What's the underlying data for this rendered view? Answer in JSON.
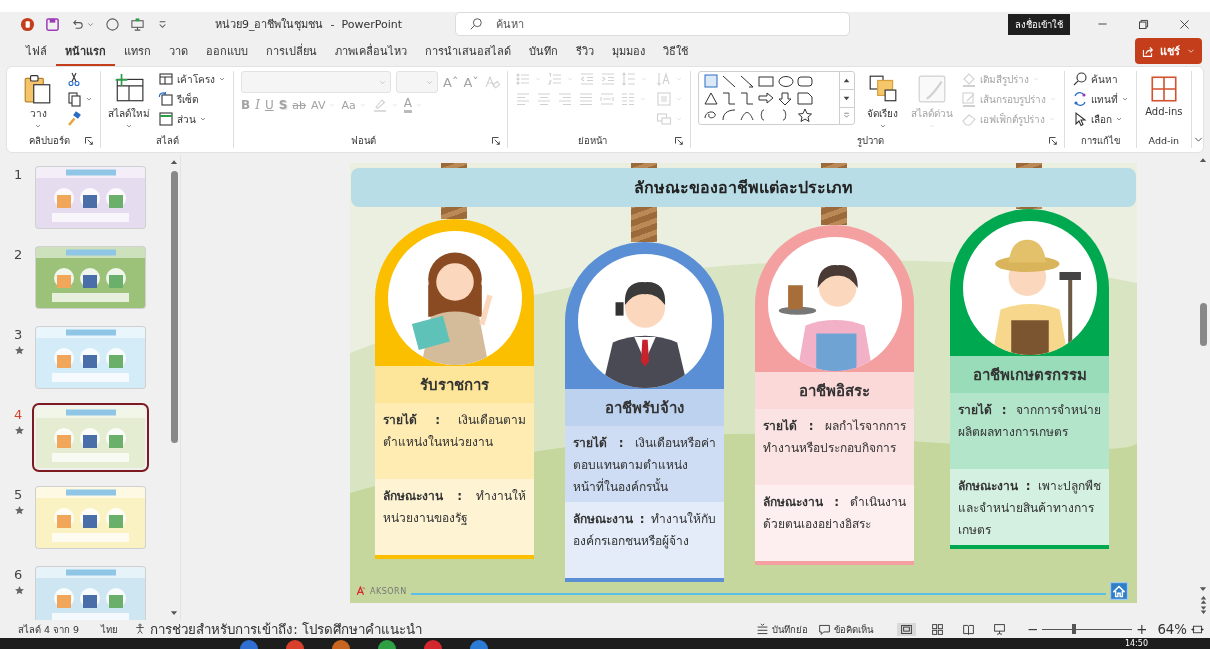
{
  "title_bar": {
    "quick_access": [
      {
        "kind": "logo",
        "dropdown": false
      },
      {
        "kind": "save",
        "dropdown": false
      },
      {
        "kind": "undo",
        "dropdown": true
      },
      {
        "kind": "redo",
        "dropdown": false
      },
      {
        "kind": "present",
        "dropdown": false
      },
      {
        "kind": "customize",
        "dropdown": false
      }
    ],
    "title": "หน่วย9_อาชีพในชุมชน  -  PowerPoint",
    "search": {
      "placeholder": "ค้นหา"
    },
    "sign_in": "ลงชื่อเข้าใช้"
  },
  "tabs": [
    {
      "label": "ไฟล์",
      "selected": false
    },
    {
      "label": "หน้าแรก",
      "selected": true
    },
    {
      "label": "แทรก",
      "selected": false
    },
    {
      "label": "วาด",
      "selected": false
    },
    {
      "label": "ออกแบบ",
      "selected": false
    },
    {
      "label": "การเปลี่ยน",
      "selected": false
    },
    {
      "label": "ภาพเคลื่อนไหว",
      "selected": false
    },
    {
      "label": "การนำเสนอสไลด์",
      "selected": false
    },
    {
      "label": "บันทึก",
      "selected": false
    },
    {
      "label": "รีวิว",
      "selected": false
    },
    {
      "label": "มุมมอง",
      "selected": false
    },
    {
      "label": "วิธีใช้",
      "selected": false
    }
  ],
  "share_button": "แชร์",
  "ribbon": {
    "groups": [
      {
        "label": "คลิปบอร์ด",
        "launcher": true,
        "columns": [
          [
            {
              "kind": "paste",
              "label": "วาง",
              "dropdown": true,
              "disabled": false
            }
          ],
          [
            {
              "kind": "cut",
              "dropdown": false,
              "disabled": false
            },
            {
              "kind": "copy",
              "dropdown": true,
              "disabled": false
            },
            {
              "kind": "painter",
              "dropdown": false,
              "disabled": false
            }
          ]
        ]
      },
      {
        "label": "สไลด์",
        "launcher": false,
        "columns": [
          [
            {
              "kind": "new_slide",
              "label": "สไลด์ใหม่",
              "dropdown": true,
              "disabled": false
            }
          ],
          [
            {
              "kind": "layout",
              "label": "เค้าโครง",
              "dropdown": true,
              "disabled": false
            },
            {
              "kind": "reset",
              "label": "รีเซ็ต",
              "dropdown": false,
              "disabled": false
            },
            {
              "kind": "section",
              "label": "ส่วน",
              "dropdown": true,
              "disabled": false
            }
          ]
        ]
      },
      {
        "label": "ฟอนต์",
        "launcher": true,
        "columns": [
          [
            {
              "kind": "row",
              "items": [
                {
                  "kind": "font_box",
                  "dropdown": true,
                  "disabled": true
                },
                {
                  "kind": "size_box",
                  "dropdown": true,
                  "disabled": true
                },
                {
                  "kind": "grow",
                  "label": "Aˆ",
                  "dropdown": false,
                  "disabled": true
                },
                {
                  "kind": "shrink",
                  "label": "Aˇ",
                  "dropdown": false,
                  "disabled": true
                },
                {
                  "kind": "clear",
                  "dropdown": false,
                  "disabled": true
                }
              ]
            },
            {
              "kind": "row",
              "items": [
                {
                  "kind": "bold",
                  "label": "B",
                  "dropdown": false,
                  "disabled": true
                },
                {
                  "kind": "italic",
                  "label": "I",
                  "dropdown": false,
                  "disabled": true
                },
                {
                  "kind": "underline",
                  "label": "U",
                  "dropdown": false,
                  "disabled": true
                },
                {
                  "kind": "shadow",
                  "label": "S",
                  "dropdown": false,
                  "disabled": true
                },
                {
                  "kind": "strike",
                  "label": "ab",
                  "dropdown": false,
                  "disabled": true
                },
                {
                  "kind": "spacing",
                  "label": "AV",
                  "dropdown": true,
                  "disabled": true
                },
                {
                  "kind": "case",
                  "label": "Aa",
                  "dropdown": true,
                  "disabled": true
                },
                {
                  "kind": "highlight",
                  "dropdown": true,
                  "disabled": true
                },
                {
                  "kind": "font_color",
                  "label": "A",
                  "dropdown": true,
                  "disabled": true
                }
              ]
            }
          ]
        ]
      },
      {
        "label": "ย่อหน้า",
        "launcher": true,
        "columns": [
          [
            {
              "kind": "row",
              "items": [
                {
                  "kind": "bullets",
                  "dropdown": true,
                  "disabled": true
                },
                {
                  "kind": "numbering",
                  "dropdown": true,
                  "disabled": true
                },
                {
                  "kind": "indent_dec",
                  "dropdown": false,
                  "disabled": true
                },
                {
                  "kind": "indent_inc",
                  "dropdown": false,
                  "disabled": true
                },
                {
                  "kind": "line_spacing",
                  "dropdown": true,
                  "disabled": true
                }
              ]
            },
            {
              "kind": "row",
              "items": [
                {
                  "kind": "align_left",
                  "dropdown": false,
                  "disabled": true
                },
                {
                  "kind": "align_center",
                  "dropdown": false,
                  "disabled": true
                },
                {
                  "kind": "align_right",
                  "dropdown": false,
                  "disabled": true
                },
                {
                  "kind": "justify",
                  "dropdown": false,
                  "disabled": true
                },
                {
                  "kind": "distributed",
                  "dropdown": false,
                  "disabled": true
                },
                {
                  "kind": "columns",
                  "dropdown": true,
                  "disabled": true
                }
              ]
            }
          ],
          [
            {
              "kind": "text_direction",
              "dropdown": true,
              "disabled": true
            },
            {
              "kind": "align_text",
              "dropdown": true,
              "disabled": true
            },
            {
              "kind": "smartart",
              "dropdown": true,
              "disabled": true
            }
          ]
        ]
      },
      {
        "label": "รูปวาด",
        "launcher": true,
        "columns": [
          [
            {
              "kind": "gallery",
              "disabled": false
            }
          ],
          [
            {
              "kind": "arrange",
              "label": "จัดเรียง",
              "dropdown": true,
              "disabled": false
            }
          ],
          [
            {
              "kind": "quick_styles",
              "label": "สไลด์ด่วน",
              "dropdown": true,
              "disabled": true
            }
          ],
          [
            {
              "kind": "shape_fill",
              "label": "เติมสีรูปร่าง",
              "dropdown": true,
              "disabled": true
            },
            {
              "kind": "shape_outline",
              "label": "เส้นกรอบรูปร่าง",
              "dropdown": true,
              "disabled": true
            },
            {
              "kind": "shape_effects",
              "label": "เอฟเฟ็กต์รูปร่าง",
              "dropdown": true,
              "disabled": true
            }
          ]
        ]
      },
      {
        "label": "การแก้ไข",
        "launcher": false,
        "columns": [
          [
            {
              "kind": "find",
              "label": "ค้นหา",
              "dropdown": false,
              "disabled": false
            },
            {
              "kind": "replace",
              "label": "แทนที่",
              "dropdown": true,
              "disabled": false
            },
            {
              "kind": "select",
              "label": "เลือก",
              "dropdown": true,
              "disabled": false
            }
          ]
        ]
      },
      {
        "label": "Add-in",
        "launcher": false,
        "columns": [
          [
            {
              "kind": "addins",
              "label": "Add-ins",
              "dropdown": false,
              "disabled": false
            }
          ]
        ]
      }
    ]
  },
  "slide_panel": {
    "slides": [
      {
        "number": "1",
        "animated": false,
        "selected": false,
        "color": "#e6dcef"
      },
      {
        "number": "2",
        "animated": false,
        "selected": false,
        "color": "#9cc27a"
      },
      {
        "number": "3",
        "animated": true,
        "selected": false,
        "color": "#d3ecf7"
      },
      {
        "number": "4",
        "animated": true,
        "selected": true,
        "color": "#e4ecd2"
      },
      {
        "number": "5",
        "animated": true,
        "selected": false,
        "color": "#fbf2c4"
      },
      {
        "number": "6",
        "animated": true,
        "selected": false,
        "color": "#cde6f2"
      }
    ]
  },
  "slide": {
    "title": "ลักษณะของอาชีพแต่ละประเภท",
    "cards": [
      {
        "kind": "teacher",
        "color": "#fbbf00",
        "title": "รับราชการ",
        "income": "**รายได้ :** เงินเดือนตามตำแหน่งในหน่วยงาน",
        "work": "**ลักษณะงาน :** ทำงานให้หน่วยงานของรัฐ"
      },
      {
        "kind": "businessman",
        "color": "#5a8fd6",
        "title": "อาชีพรับจ้าง",
        "income": "**รายได้ :** เงินเดือนหรือค่าตอบแทนตามตำแหน่งหน้าที่ในองค์กรนั้น",
        "work": "**ลักษณะงาน :** ทำงานให้กับองค์กรเอกชนหรือผู้จ้าง"
      },
      {
        "kind": "waitress",
        "color": "#f4a0a0",
        "title": "อาชีพอิสระ",
        "income": "**รายได้ :** ผลกำไรจากการทำงานหรือประกอบกิจการ",
        "work": "**ลักษณะงาน :** ดำเนินงานด้วยตนเองอย่างอิสระ"
      },
      {
        "kind": "farmer",
        "color": "#00a84f",
        "title": "อาชีพเกษตรกรรม",
        "income": "**รายได้ :** จากการจำหน่ายผลิตผลทางการเกษตร",
        "work": "**ลักษณะงาน :** เพาะปลูกพืชและจำหน่ายสินค้าทางการเกษตร"
      }
    ],
    "logo": "AKSORN"
  },
  "status_bar": {
    "slide_count": "สไลด์ 4 จาก 9",
    "language": "ไทย",
    "accessibility": "การช่วยสำหรับการเข้าถึง: โปรดศึกษาคำแนะนำ",
    "notes": "บันทึกย่อ",
    "comments": "ข้อคิดเห็น",
    "views": [
      {
        "kind": "normal",
        "selected": true
      },
      {
        "kind": "sorter",
        "selected": false
      },
      {
        "kind": "reading",
        "selected": false
      },
      {
        "kind": "slideshow",
        "selected": false
      }
    ],
    "zoom": {
      "out": "−",
      "in": "+",
      "level": 0.35,
      "reading": "64%"
    }
  },
  "taskbar": {
    "clock": "14:50"
  }
}
